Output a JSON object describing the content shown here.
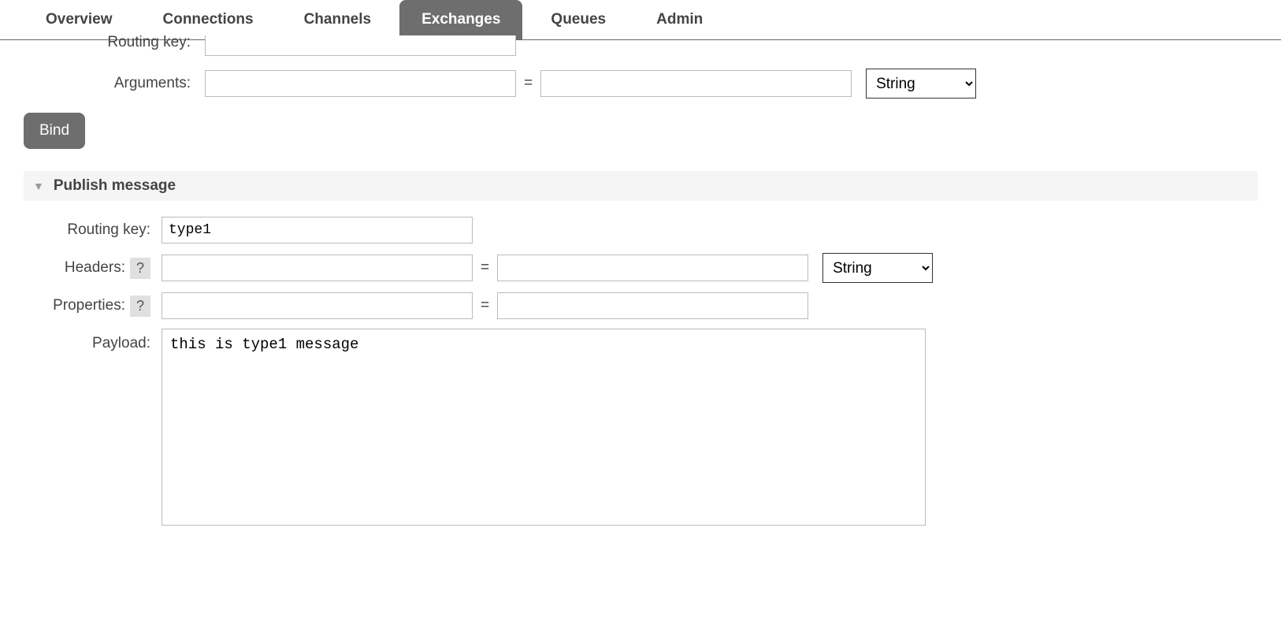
{
  "tabs": {
    "overview": "Overview",
    "connections": "Connections",
    "channels": "Channels",
    "exchanges": "Exchanges",
    "queues": "Queues",
    "admin": "Admin"
  },
  "binding": {
    "routing_key_label": "Routing key:",
    "routing_key_value": "",
    "arguments_label": "Arguments:",
    "arg_key": "",
    "arg_value": "",
    "type_options": [
      "String"
    ],
    "bind_button": "Bind"
  },
  "publish": {
    "section_title": "Publish message",
    "routing_key_label": "Routing key:",
    "routing_key_value": "type1",
    "headers_label": "Headers:",
    "headers_key": "",
    "headers_value": "",
    "headers_type_options": [
      "String"
    ],
    "properties_label": "Properties:",
    "properties_key": "",
    "properties_value": "",
    "payload_label": "Payload:",
    "payload_value": "this is type1 message",
    "help_symbol": "?"
  },
  "equals_symbol": "="
}
